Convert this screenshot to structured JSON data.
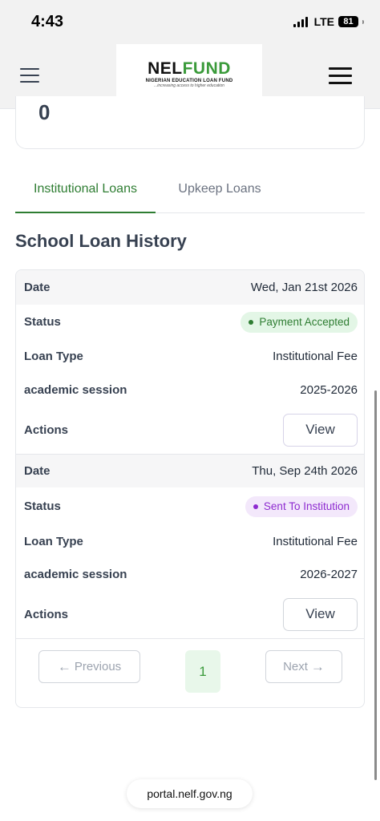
{
  "status_bar": {
    "time": "4:43",
    "network": "LTE",
    "battery": "81"
  },
  "header": {
    "logo_nel": "NEL",
    "logo_fund": "FUND",
    "logo_subtitle": "NIGERIAN EDUCATION LOAN FUND",
    "logo_tagline": "...increasing access to higher education"
  },
  "summary": {
    "value": "0"
  },
  "tabs": [
    {
      "label": "Institutional Loans",
      "active": true
    },
    {
      "label": "Upkeep Loans",
      "active": false
    }
  ],
  "section_title": "School Loan History",
  "labels": {
    "date": "Date",
    "status": "Status",
    "loan_type": "Loan Type",
    "academic_session": "academic session",
    "actions": "Actions",
    "view": "View"
  },
  "loans": [
    {
      "date": "Wed, Jan 21st 2026",
      "status": "Payment Accepted",
      "loan_type": "Institutional Fee",
      "academic_session": "2025-2026"
    },
    {
      "date": "Thu, Sep 24th 2026",
      "status": "Sent To Institution",
      "loan_type": "Institutional Fee",
      "academic_session": "2026-2027"
    }
  ],
  "pagination": {
    "previous": "Previous",
    "page": "1",
    "next": "Next"
  },
  "url": "portal.nelf.gov.ng",
  "colors": {
    "accent": "#2e7d32",
    "status_accepted": "#2e7d32",
    "status_sent": "#8e2bd0"
  }
}
